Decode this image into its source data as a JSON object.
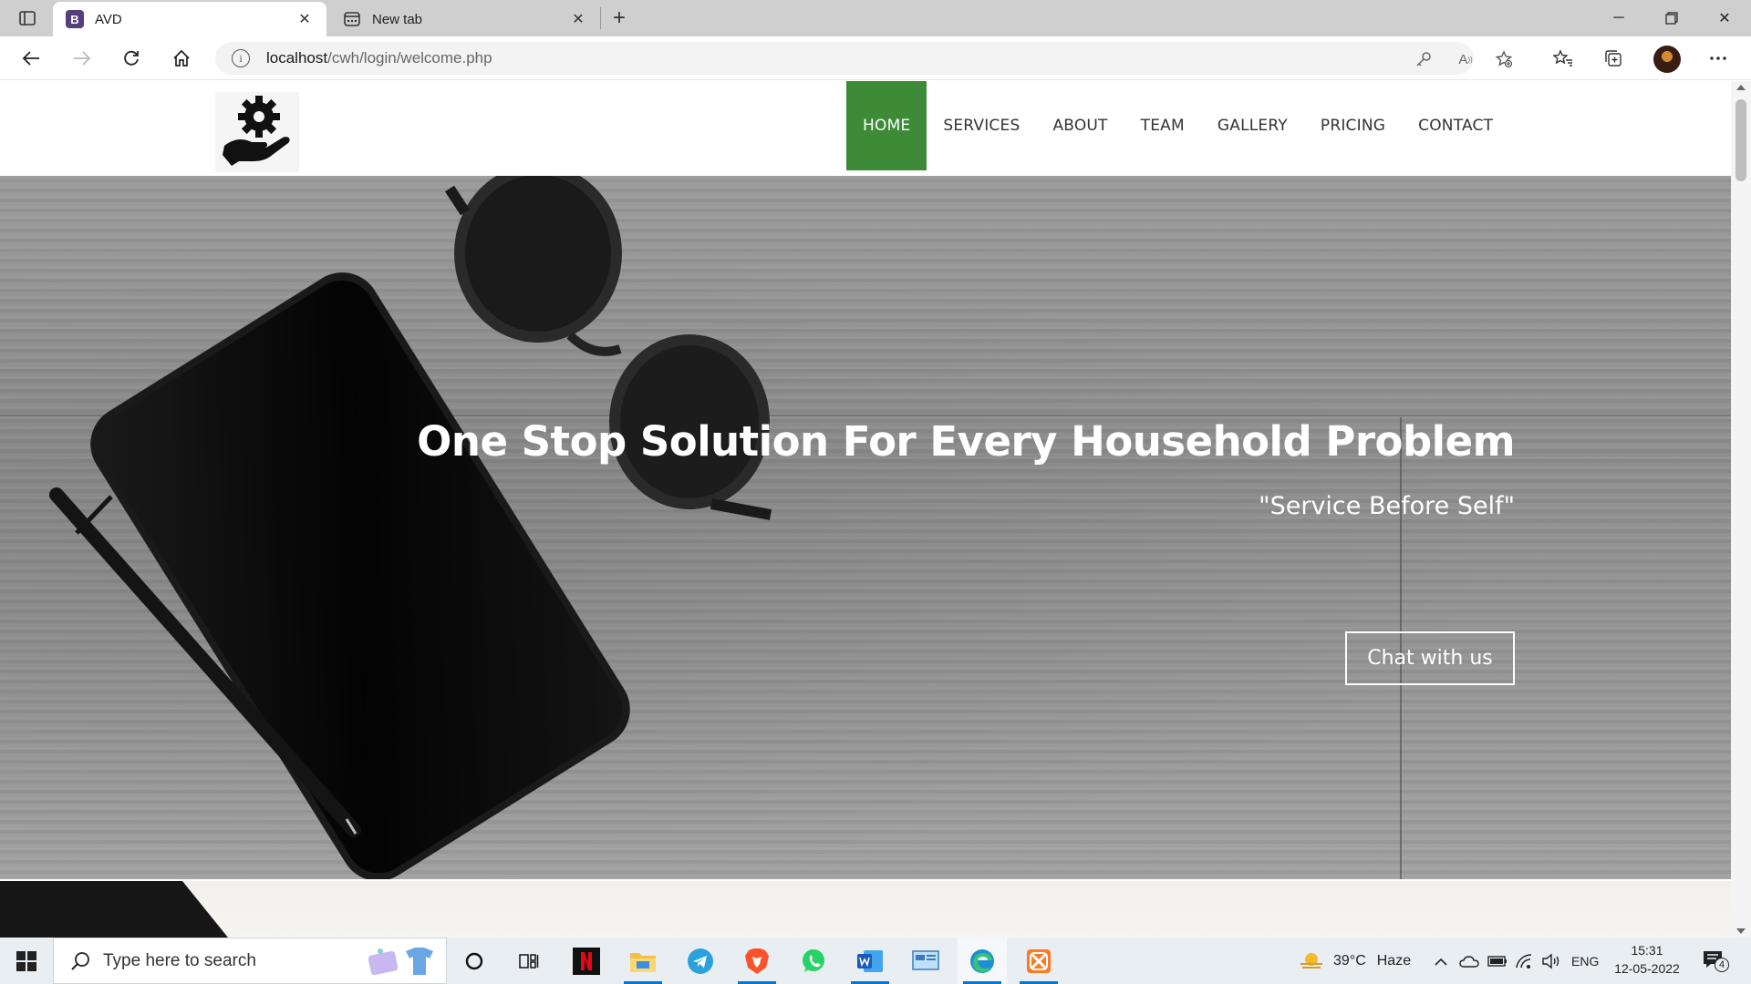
{
  "browser": {
    "tabs": [
      {
        "label": "AVD",
        "favicon": "B",
        "active": true
      },
      {
        "label": "New tab",
        "active": false
      }
    ],
    "address": {
      "host": "localhost",
      "path": "/cwh/login/welcome.php"
    }
  },
  "site": {
    "nav": {
      "items": [
        {
          "label": "HOME",
          "active": true
        },
        {
          "label": "SERVICES"
        },
        {
          "label": "ABOUT"
        },
        {
          "label": "TEAM"
        },
        {
          "label": "GALLERY"
        },
        {
          "label": "PRICING"
        },
        {
          "label": "CONTACT"
        }
      ],
      "active_color": "#3d8b37"
    },
    "hero": {
      "title": "One Stop Solution For Every Household Problem",
      "subtitle": "\"Service Before Self\"",
      "button_label": "Chat with us"
    }
  },
  "taskbar": {
    "search_placeholder": "Type here to search",
    "weather": {
      "temp": "39°C",
      "condition": "Haze"
    },
    "language": "ENG",
    "time": "15:31",
    "date": "12-05-2022",
    "notification_count": "4",
    "apps": [
      "cortana-icon",
      "task-view-icon",
      "netflix-icon",
      "file-explorer-icon",
      "telegram-icon",
      "brave-icon",
      "whatsapp-icon",
      "word-icon",
      "control-panel-icon",
      "edge-icon",
      "xampp-icon"
    ]
  }
}
